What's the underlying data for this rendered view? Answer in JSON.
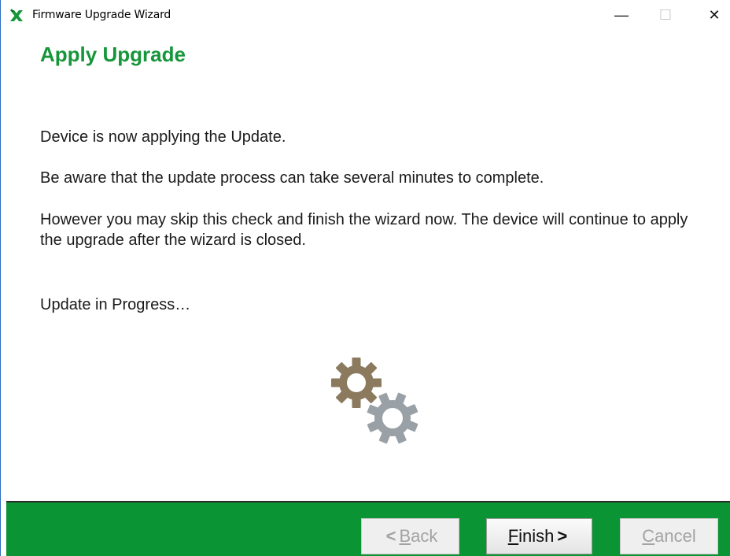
{
  "window": {
    "title": "Firmware Upgrade Wizard",
    "controls": {
      "minimize": "—",
      "maximize": "☐",
      "close": "✕"
    }
  },
  "page": {
    "heading": "Apply Upgrade",
    "paragraphs": {
      "p1": "Device is now applying the Update.",
      "p2": "Be aware that the update process can take several minutes to complete.",
      "p3": "However you may skip this check and finish the wizard now.  The device will continue to apply the upgrade after the wizard is closed.",
      "status": "Update in Progress…"
    },
    "icons": [
      "wizard-app-icon",
      "gears-progress-icon"
    ]
  },
  "footer": {
    "back": {
      "prefix": "<",
      "mnemonic": "B",
      "rest": "ack",
      "enabled": false
    },
    "finish": {
      "mnemonic": "F",
      "rest": "inish",
      "suffix": ">",
      "enabled": true
    },
    "cancel": {
      "mnemonic": "C",
      "rest": "ancel",
      "enabled": false
    }
  },
  "colors": {
    "accent_green": "#16963a",
    "footer_green": "#0b9433",
    "gear_brown": "#8b7a5e",
    "gear_gray": "#9aa1a6"
  }
}
